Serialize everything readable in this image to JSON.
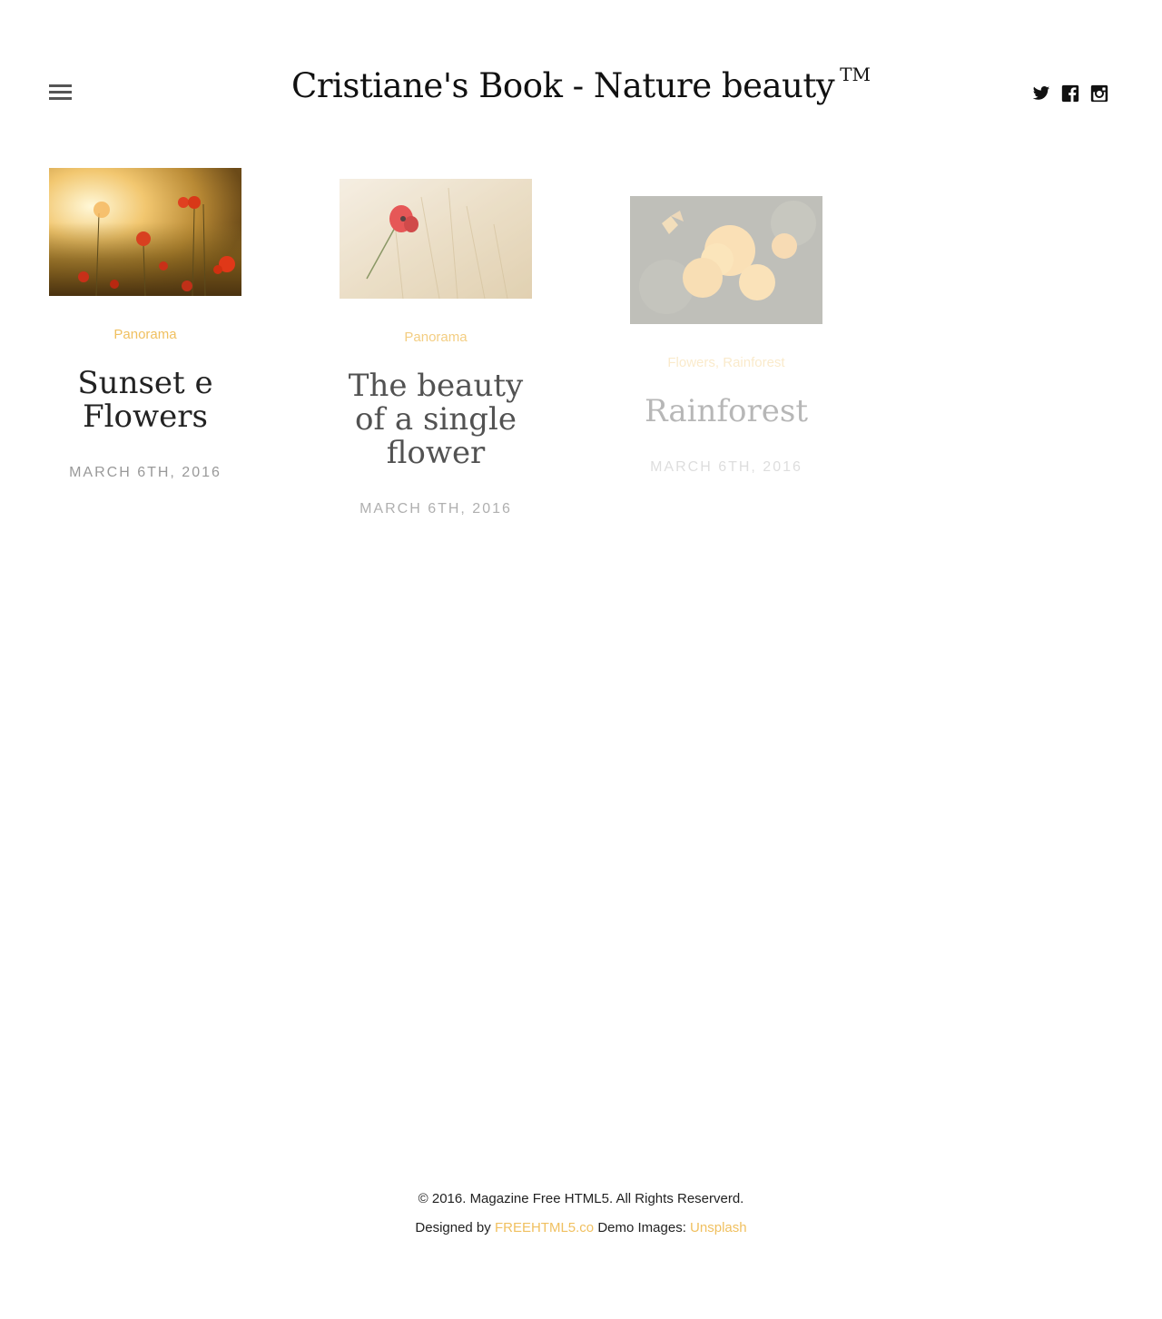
{
  "header": {
    "title": "Cristiane's Book - Nature beauty",
    "trademark": "TM",
    "social": [
      {
        "name": "twitter-icon"
      },
      {
        "name": "facebook-icon"
      },
      {
        "name": "instagram-icon"
      }
    ]
  },
  "posts": [
    {
      "category": "Panorama",
      "title": "Sunset e Flowers",
      "date": "March 6th, 2016"
    },
    {
      "category": "Panorama",
      "title": "The beauty of a single flower",
      "date": "March 6th, 2016"
    },
    {
      "categories": [
        "Flowers",
        "Rainforest"
      ],
      "separator": ", ",
      "title": "Rainforest",
      "date": "March 6th, 2016"
    }
  ],
  "footer": {
    "copyright": "© 2016. Magazine Free HTML5. All Rights Reserverd.",
    "designed_by": "Designed by",
    "designer_link": "FREEHTML5.co",
    "demo_images": "Demo Images:",
    "images_link": "Unsplash"
  },
  "colors": {
    "accent": "#f0c060",
    "text": "#222222",
    "muted": "#999999"
  }
}
